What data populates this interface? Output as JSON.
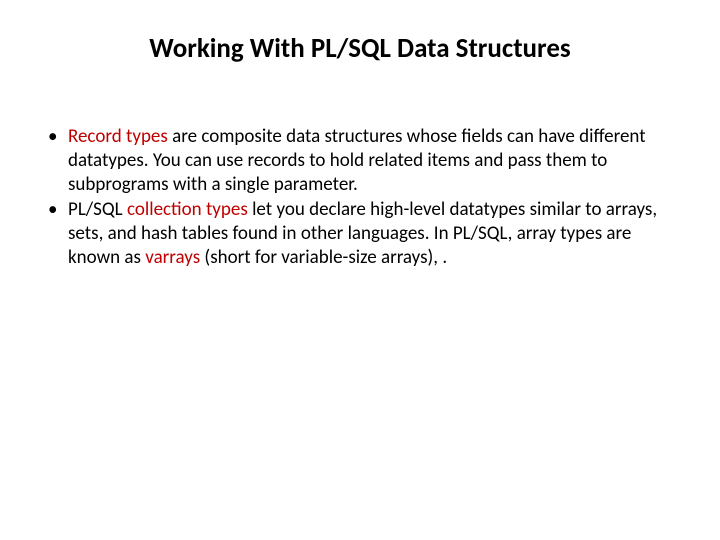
{
  "title": "Working With PL/SQL Data Structures",
  "bullet1": {
    "t1": "Record types",
    "t2": " are composite data structures whose fields can have different datatypes. You can use records to hold related items and pass them to subprograms with a single parameter."
  },
  "bullet2": {
    "t1": "PL/SQL ",
    "t2": "collection types",
    "t3": " let you declare high-level datatypes similar to arrays, sets, and hash tables found in other languages. In PL/SQL, array types are known as ",
    "t4": "varrays",
    "t5": " (short for variable-size arrays), ."
  }
}
